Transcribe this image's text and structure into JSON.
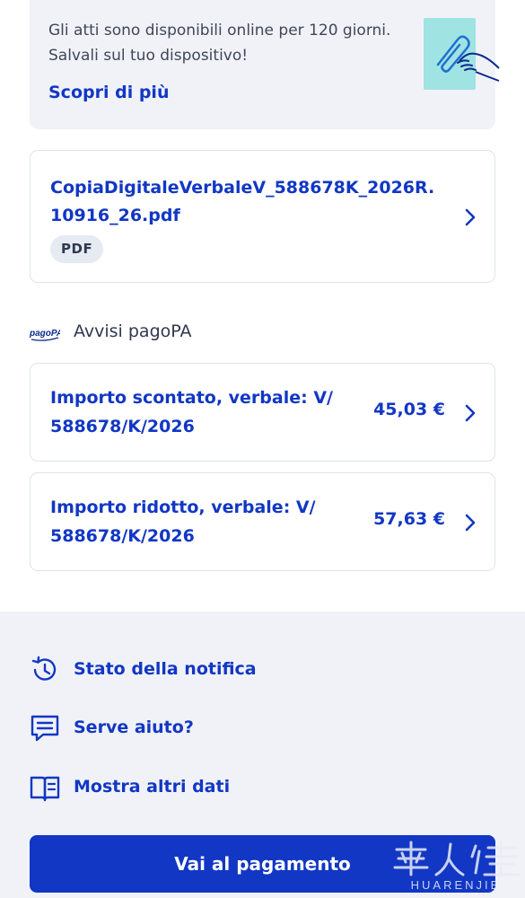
{
  "info_banner": {
    "text": "Gli atti sono disponibili online per 120 giorni. Salvali sul tuo dispositivo!",
    "link": "Scopri di più",
    "illustration": "paperclip-hand-illustration"
  },
  "document": {
    "filename": "CopiaDigitaleVerbaleV_588678K_2026R.10916_26.pdf",
    "badge": "PDF",
    "icon": "chevron-right-icon"
  },
  "pagopa_section": {
    "logo_text": "pagoPA",
    "title": "Avvisi pagoPA",
    "notices": [
      {
        "label": "Importo scontato, verbale: V/ 588678/K/2026",
        "amount": "45,03 €"
      },
      {
        "label": "Importo ridotto, verbale: V/ 588678/K/2026",
        "amount": "57,63 €"
      }
    ]
  },
  "actions": [
    {
      "label": "Stato della notifica",
      "icon": "history-icon"
    },
    {
      "label": "Serve aiuto?",
      "icon": "chat-icon"
    },
    {
      "label": "Mostra altri dati",
      "icon": "book-icon"
    }
  ],
  "primary_button": {
    "label": "Vai al pagamento"
  },
  "watermark": {
    "text": "HUARENJIE"
  },
  "colors": {
    "primary": "#1237c4",
    "panel_bg": "#f0f2f7",
    "border": "#dfe3ea",
    "illustration_bg": "#9fe3e3"
  }
}
